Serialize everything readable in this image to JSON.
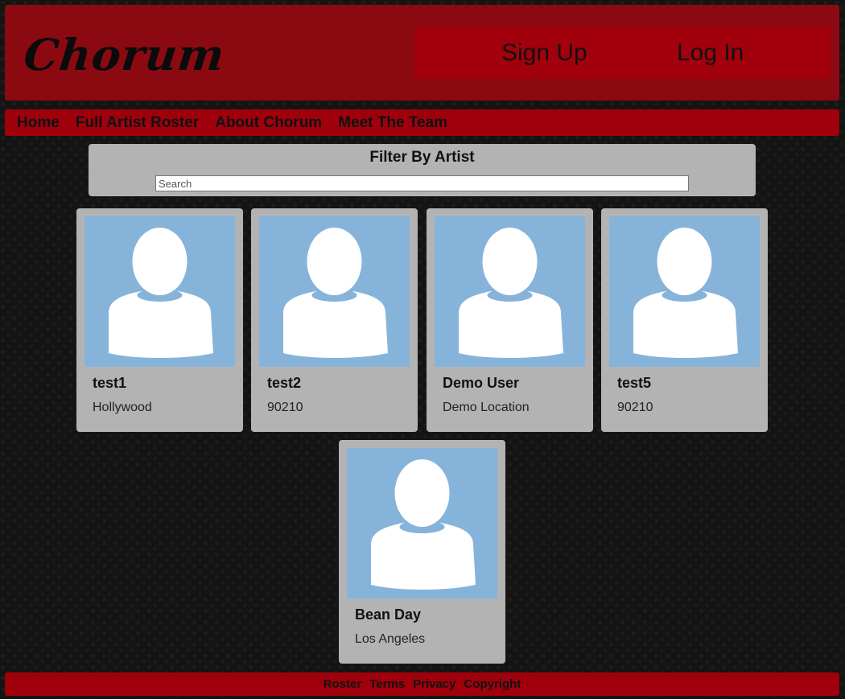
{
  "header": {
    "logo_text": "Chorum",
    "sign_up_label": "Sign Up",
    "log_in_label": "Log In"
  },
  "nav": {
    "items": [
      {
        "label": "Home"
      },
      {
        "label": "Full Artist Roster"
      },
      {
        "label": "About Chorum"
      },
      {
        "label": "Meet The Team"
      }
    ]
  },
  "filter": {
    "title": "Filter By Artist",
    "search_placeholder": "Search",
    "search_value": ""
  },
  "artists": [
    {
      "name": "test1",
      "location": "Hollywood",
      "avatar_icon": "default-user-avatar-icon"
    },
    {
      "name": "test2",
      "location": "90210",
      "avatar_icon": "default-user-avatar-icon"
    },
    {
      "name": "Demo User",
      "location": "Demo Location",
      "avatar_icon": "default-user-avatar-icon"
    },
    {
      "name": "test5",
      "location": "90210",
      "avatar_icon": "default-user-avatar-icon"
    },
    {
      "name": "Bean Day",
      "location": "Los Angeles",
      "avatar_icon": "default-user-avatar-icon"
    }
  ],
  "footer": {
    "links": [
      {
        "label": "Roster"
      },
      {
        "label": "Terms"
      },
      {
        "label": "Privacy"
      },
      {
        "label": "Copyright"
      }
    ]
  },
  "colors": {
    "header_bg": "#8b0a12",
    "nav_bg": "#a0000c",
    "card_bg": "#b3b3b3",
    "avatar_bg": "#86b3da"
  }
}
